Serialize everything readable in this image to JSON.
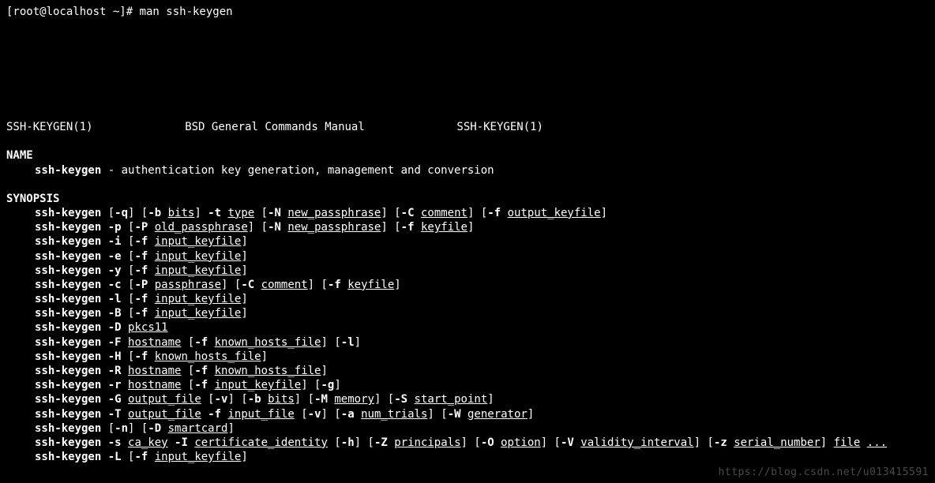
{
  "prompt": "[root@localhost ~]# man ssh-keygen",
  "header": {
    "left": "SSH-KEYGEN(1)",
    "center": "BSD General Commands Manual",
    "right": "SSH-KEYGEN(1)"
  },
  "name": {
    "title": "NAME",
    "cmd": "ssh-keygen",
    "desc": " - authentication key generation, management and conversion"
  },
  "synopsis": {
    "title": "SYNOPSIS",
    "lines": [
      [
        {
          "b": "ssh-keygen"
        },
        " [",
        {
          "b": "-q"
        },
        "] [",
        {
          "b": "-b"
        },
        " ",
        {
          "u": "bits"
        },
        "] ",
        {
          "b": "-t"
        },
        " ",
        {
          "u": "type"
        },
        " [",
        {
          "b": "-N"
        },
        " ",
        {
          "u": "new_passphrase"
        },
        "] [",
        {
          "b": "-C"
        },
        " ",
        {
          "u": "comment"
        },
        "] [",
        {
          "b": "-f"
        },
        " ",
        {
          "u": "output_keyfile"
        },
        "]"
      ],
      [
        {
          "b": "ssh-keygen"
        },
        " ",
        {
          "b": "-p"
        },
        " [",
        {
          "b": "-P"
        },
        " ",
        {
          "u": "old_passphrase"
        },
        "] [",
        {
          "b": "-N"
        },
        " ",
        {
          "u": "new_passphrase"
        },
        "] [",
        {
          "b": "-f"
        },
        " ",
        {
          "u": "keyfile"
        },
        "]"
      ],
      [
        {
          "b": "ssh-keygen"
        },
        " ",
        {
          "b": "-i"
        },
        " [",
        {
          "b": "-f"
        },
        " ",
        {
          "u": "input_keyfile"
        },
        "]"
      ],
      [
        {
          "b": "ssh-keygen"
        },
        " ",
        {
          "b": "-e"
        },
        " [",
        {
          "b": "-f"
        },
        " ",
        {
          "u": "input_keyfile"
        },
        "]"
      ],
      [
        {
          "b": "ssh-keygen"
        },
        " ",
        {
          "b": "-y"
        },
        " [",
        {
          "b": "-f"
        },
        " ",
        {
          "u": "input_keyfile"
        },
        "]"
      ],
      [
        {
          "b": "ssh-keygen"
        },
        " ",
        {
          "b": "-c"
        },
        " [",
        {
          "b": "-P"
        },
        " ",
        {
          "u": "passphrase"
        },
        "] [",
        {
          "b": "-C"
        },
        " ",
        {
          "u": "comment"
        },
        "] [",
        {
          "b": "-f"
        },
        " ",
        {
          "u": "keyfile"
        },
        "]"
      ],
      [
        {
          "b": "ssh-keygen"
        },
        " ",
        {
          "b": "-l"
        },
        " [",
        {
          "b": "-f"
        },
        " ",
        {
          "u": "input_keyfile"
        },
        "]"
      ],
      [
        {
          "b": "ssh-keygen"
        },
        " ",
        {
          "b": "-B"
        },
        " [",
        {
          "b": "-f"
        },
        " ",
        {
          "u": "input_keyfile"
        },
        "]"
      ],
      [
        {
          "b": "ssh-keygen"
        },
        " ",
        {
          "b": "-D"
        },
        " ",
        {
          "u": "pkcs11"
        }
      ],
      [
        {
          "b": "ssh-keygen"
        },
        " ",
        {
          "b": "-F"
        },
        " ",
        {
          "u": "hostname"
        },
        " [",
        {
          "b": "-f"
        },
        " ",
        {
          "u": "known_hosts_file"
        },
        "] [",
        {
          "b": "-l"
        },
        "]"
      ],
      [
        {
          "b": "ssh-keygen"
        },
        " ",
        {
          "b": "-H"
        },
        " [",
        {
          "b": "-f"
        },
        " ",
        {
          "u": "known_hosts_file"
        },
        "]"
      ],
      [
        {
          "b": "ssh-keygen"
        },
        " ",
        {
          "b": "-R"
        },
        " ",
        {
          "u": "hostname"
        },
        " [",
        {
          "b": "-f"
        },
        " ",
        {
          "u": "known_hosts_file"
        },
        "]"
      ],
      [
        {
          "b": "ssh-keygen"
        },
        " ",
        {
          "b": "-r"
        },
        " ",
        {
          "u": "hostname"
        },
        " [",
        {
          "b": "-f"
        },
        " ",
        {
          "u": "input_keyfile"
        },
        "] [",
        {
          "b": "-g"
        },
        "]"
      ],
      [
        {
          "b": "ssh-keygen"
        },
        " ",
        {
          "b": "-G"
        },
        " ",
        {
          "u": "output_file"
        },
        " [",
        {
          "b": "-v"
        },
        "] [",
        {
          "b": "-b"
        },
        " ",
        {
          "u": "bits"
        },
        "] [",
        {
          "b": "-M"
        },
        " ",
        {
          "u": "memory"
        },
        "] [",
        {
          "b": "-S"
        },
        " ",
        {
          "u": "start_point"
        },
        "]"
      ],
      [
        {
          "b": "ssh-keygen"
        },
        " ",
        {
          "b": "-T"
        },
        " ",
        {
          "u": "output_file"
        },
        " ",
        {
          "b": "-f"
        },
        " ",
        {
          "u": "input_file"
        },
        " [",
        {
          "b": "-v"
        },
        "] [",
        {
          "b": "-a"
        },
        " ",
        {
          "u": "num_trials"
        },
        "] [",
        {
          "b": "-W"
        },
        " ",
        {
          "u": "generator"
        },
        "]"
      ],
      [
        {
          "b": "ssh-keygen"
        },
        " [",
        {
          "b": "-n"
        },
        "] [",
        {
          "b": "-D"
        },
        " ",
        {
          "u": "smartcard"
        },
        "]"
      ],
      [
        {
          "b": "ssh-keygen"
        },
        " ",
        {
          "b": "-s"
        },
        " ",
        {
          "u": "ca_key"
        },
        " ",
        {
          "b": "-I"
        },
        " ",
        {
          "u": "certificate_identity"
        },
        " [",
        {
          "b": "-h"
        },
        "] [",
        {
          "b": "-Z"
        },
        " ",
        {
          "u": "principals"
        },
        "] [",
        {
          "b": "-O"
        },
        " ",
        {
          "u": "option"
        },
        "] [",
        {
          "b": "-V"
        },
        " ",
        {
          "u": "validity_interval"
        },
        "] [",
        {
          "b": "-z"
        },
        " ",
        {
          "u": "serial_number"
        },
        "] ",
        {
          "u": "file"
        },
        " ",
        {
          "u": "..."
        }
      ],
      [
        {
          "b": "ssh-keygen"
        },
        " ",
        {
          "b": "-L"
        },
        " [",
        {
          "b": "-f"
        },
        " ",
        {
          "u": "input_keyfile"
        },
        "]"
      ]
    ]
  },
  "watermark": "https://blog.csdn.net/u013415591"
}
